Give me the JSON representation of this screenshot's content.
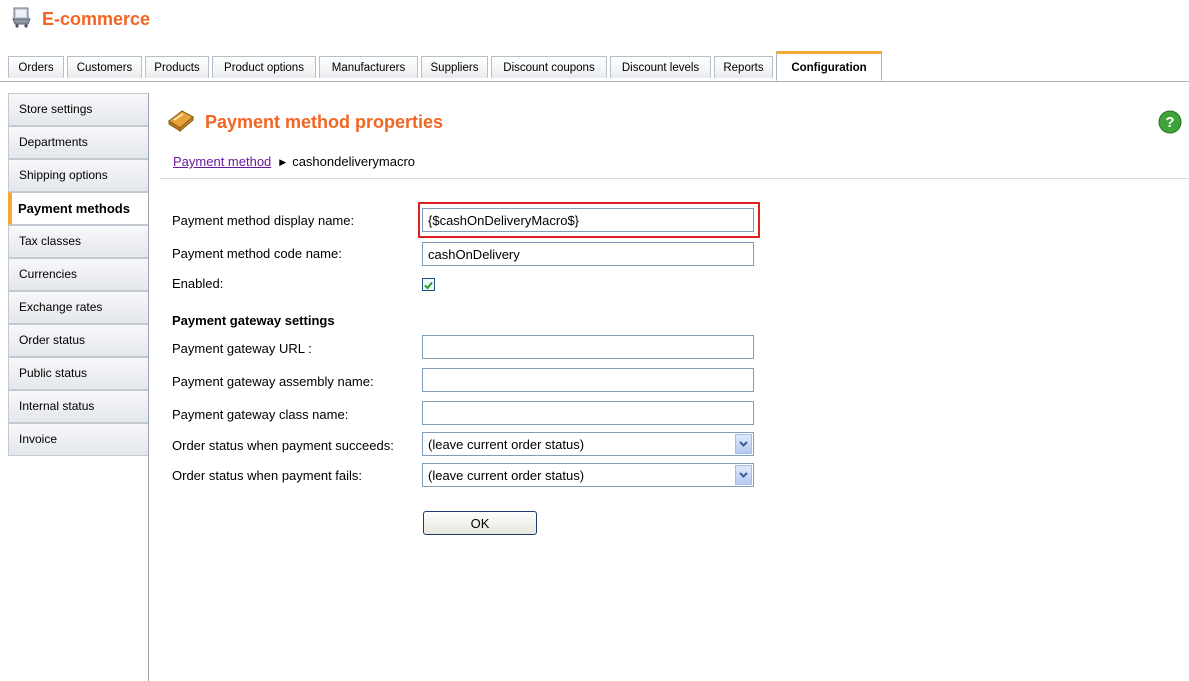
{
  "app": {
    "title": "E-commerce"
  },
  "tabs": [
    {
      "label": "Orders"
    },
    {
      "label": "Customers"
    },
    {
      "label": "Products"
    },
    {
      "label": "Product options"
    },
    {
      "label": "Manufacturers"
    },
    {
      "label": "Suppliers"
    },
    {
      "label": "Discount coupons"
    },
    {
      "label": "Discount levels"
    },
    {
      "label": "Reports"
    },
    {
      "label": "Configuration",
      "active": true
    }
  ],
  "sidebar": {
    "items": [
      {
        "label": "Store settings"
      },
      {
        "label": "Departments"
      },
      {
        "label": "Shipping options"
      },
      {
        "label": "Payment methods",
        "active": true
      },
      {
        "label": "Tax classes"
      },
      {
        "label": "Currencies"
      },
      {
        "label": "Exchange rates"
      },
      {
        "label": "Order status"
      },
      {
        "label": "Public status"
      },
      {
        "label": "Internal status"
      },
      {
        "label": "Invoice"
      }
    ]
  },
  "page": {
    "title": "Payment method properties",
    "help_icon": "help-icon",
    "breadcrumb": {
      "link": "Payment method",
      "current": "cashondeliverymacro"
    }
  },
  "form": {
    "display_name": {
      "label": "Payment method display name:",
      "value": "{$cashOnDeliveryMacro$}"
    },
    "code_name": {
      "label": "Payment method code name:",
      "value": "cashOnDelivery"
    },
    "enabled": {
      "label": "Enabled:",
      "checked": true
    },
    "gateway_section": "Payment gateway settings",
    "gateway_url": {
      "label": "Payment gateway URL :",
      "value": ""
    },
    "gateway_assembly": {
      "label": "Payment gateway assembly name:",
      "value": ""
    },
    "gateway_class": {
      "label": "Payment gateway class name:",
      "value": ""
    },
    "status_success": {
      "label": "Order status when payment succeeds:",
      "value": "(leave current order status)"
    },
    "status_fail": {
      "label": "Order status when payment fails:",
      "value": "(leave current order status)"
    },
    "ok_label": "OK"
  },
  "colors": {
    "accent": "#f26522",
    "highlight_border": "#e02020",
    "tab_active_top": "#f4a83a"
  }
}
